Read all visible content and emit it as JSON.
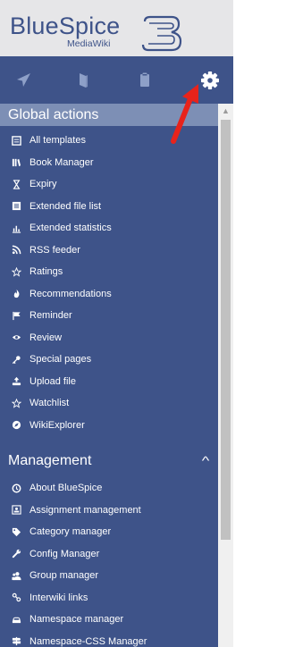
{
  "logo": {
    "brand": "BlueSpice",
    "subtitle": "MediaWiki",
    "version_mark": "3"
  },
  "toolbar": {
    "buttons": [
      {
        "icon": "navigation-arrow-icon"
      },
      {
        "icon": "book-icon"
      },
      {
        "icon": "clipboard-icon"
      },
      {
        "icon": "gear-icon"
      }
    ]
  },
  "sections": {
    "global": {
      "title": "Global actions",
      "items": [
        {
          "label": "All templates",
          "icon": "list-icon"
        },
        {
          "label": "Book Manager",
          "icon": "books-icon"
        },
        {
          "label": "Expiry",
          "icon": "hourglass-icon"
        },
        {
          "label": "Extended file list",
          "icon": "file-list-icon"
        },
        {
          "label": "Extended statistics",
          "icon": "bar-chart-icon"
        },
        {
          "label": "RSS feeder",
          "icon": "rss-icon"
        },
        {
          "label": "Ratings",
          "icon": "star-outline-icon"
        },
        {
          "label": "Recommendations",
          "icon": "flame-icon"
        },
        {
          "label": "Reminder",
          "icon": "flag-icon"
        },
        {
          "label": "Review",
          "icon": "eye-icon"
        },
        {
          "label": "Special pages",
          "icon": "key-icon"
        },
        {
          "label": "Upload file",
          "icon": "upload-icon"
        },
        {
          "label": "Watchlist",
          "icon": "star-outline-icon"
        },
        {
          "label": "WikiExplorer",
          "icon": "compass-icon"
        }
      ]
    },
    "management": {
      "title": "Management",
      "items": [
        {
          "label": "About BlueSpice",
          "icon": "info-circle-icon"
        },
        {
          "label": "Assignment management",
          "icon": "assignment-icon"
        },
        {
          "label": "Category manager",
          "icon": "tag-icon"
        },
        {
          "label": "Config Manager",
          "icon": "wrench-icon"
        },
        {
          "label": "Group manager",
          "icon": "group-icon"
        },
        {
          "label": "Interwiki links",
          "icon": "link-icon"
        },
        {
          "label": "Namespace manager",
          "icon": "car-icon"
        },
        {
          "label": "Namespace-CSS Manager",
          "icon": "signpost-icon"
        }
      ]
    }
  },
  "colors": {
    "sidebar_bg": "#3e5389",
    "section_head_bg": "#7d8fb5",
    "logo_bg": "#e6e6e8",
    "annotation_arrow": "#e8231b"
  }
}
